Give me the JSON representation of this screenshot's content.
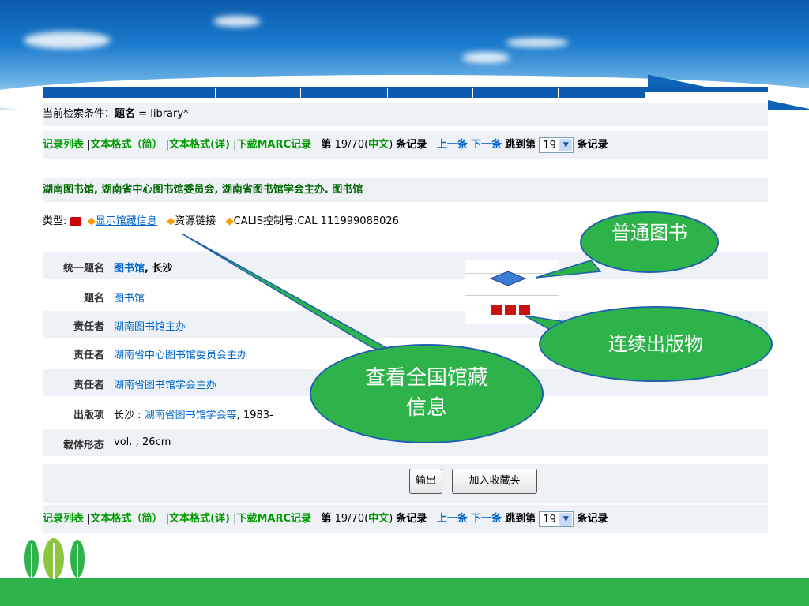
{
  "search_condition": {
    "label": "当前检索条件：",
    "field": "题名",
    "op": "=",
    "value": "library*"
  },
  "nav": {
    "record_list": "记录列表",
    "text_brief": "文本格式（简）",
    "text_full": "文本格式(详)",
    "download_prefix": "下载",
    "download_marc": "MARC",
    "download_suffix": "记录",
    "record_prefix": "第",
    "record_pos": "19/70",
    "lang_open": "(",
    "lang": "中文",
    "lang_close": ")",
    "record_suffix": "条记录",
    "prev": "上一条",
    "next": "下一条",
    "jump_prefix": "跳到第",
    "jump_value": "19",
    "jump_suffix": "条记录"
  },
  "record_title": "湖南图书馆, 湖南省中心图书馆委员会, 湖南省图书馆学会主办. 图书馆",
  "info_line": {
    "type_label": "类型:",
    "show_holdings": "显示馆藏信息",
    "resource_link": "资源链接",
    "calis_label": "CALIS控制号:",
    "calis_value": "CAL 111999088026"
  },
  "fields": [
    {
      "label": "统一题名",
      "value": "图书馆",
      "value_suffix": ", 长沙"
    },
    {
      "label": "题名",
      "value": "图书馆"
    },
    {
      "label": "责任者",
      "value": "湖南图书馆主办"
    },
    {
      "label": "责任者",
      "value": "湖南省中心图书馆委员会主办"
    },
    {
      "label": "责任者",
      "value": "湖南省图书馆学会主办"
    },
    {
      "label": "出版项",
      "value_prefix": "长沙 : ",
      "value": "湖南省图书馆学会等",
      "value_suffix": ", 1983-"
    },
    {
      "label": "载体形态",
      "value": "vol. ; 26cm"
    }
  ],
  "buttons": {
    "export": "输出",
    "add_favorites": "加入收藏夹"
  },
  "callouts": {
    "regular_book": "普通图书",
    "serial": "连续出版物",
    "national_holdings": "查看全国馆藏信息"
  },
  "colors": {
    "callout_fill": "#2db34a",
    "link": "#0066cc",
    "green_link": "#009900",
    "header_blue": "#0c5bb0"
  }
}
